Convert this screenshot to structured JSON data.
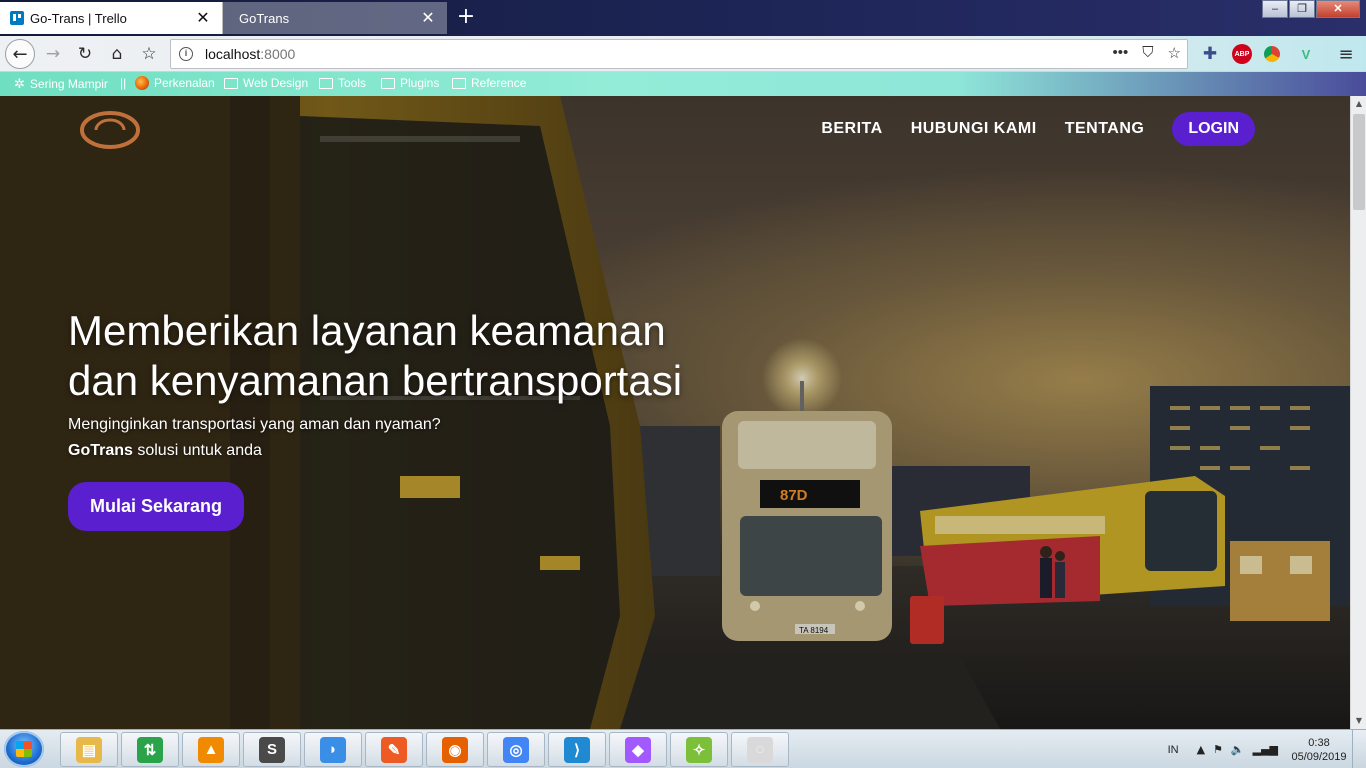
{
  "browser": {
    "tabs": [
      {
        "title": "Go-Trans | Trello",
        "active": false
      },
      {
        "title": "GoTrans",
        "active": true
      }
    ],
    "new_tab_glyph": "+",
    "close_glyph": "✕",
    "url": {
      "host": "localhost",
      "port": ":8000"
    },
    "url_actions": [
      "•••",
      "⛉",
      "☆"
    ],
    "bookmarks": [
      {
        "label": "Sering Mampir",
        "icon": "gear-icon"
      },
      {
        "label": "Perkenalan",
        "icon": "firefox-icon"
      },
      {
        "label": "Web Design",
        "icon": "folder-icon"
      },
      {
        "label": "Tools",
        "icon": "folder-icon"
      },
      {
        "label": "Plugins",
        "icon": "folder-icon"
      },
      {
        "label": "Reference",
        "icon": "folder-icon"
      }
    ],
    "extensions": {
      "abp": "ABP",
      "vue": "V"
    }
  },
  "site": {
    "nav": {
      "berita": "BERITA",
      "hubungi": "HUBUNGI KAMI",
      "tentang": "TENTANG",
      "login": "LOGIN"
    },
    "hero": {
      "title": "Memberikan layanan keamanan dan kenyamanan bertransportasi",
      "subtitle_line1": "Menginginkan transportasi yang aman dan nyaman?",
      "brand": "GoTrans",
      "subtitle_line2": " solusi untuk anda",
      "cta": "Mulai Sekarang"
    },
    "scene_text": {
      "bus_sign": "87D",
      "bus_plate": "TA 8194"
    },
    "colors": {
      "accent": "#5a1fcf",
      "logo": "#c0703a"
    }
  },
  "taskbar": {
    "apps": [
      {
        "name": "file-explorer",
        "color": "#e6b94a"
      },
      {
        "name": "download-manager",
        "color": "#2aa34a"
      },
      {
        "name": "vlc",
        "color": "#f08a00"
      },
      {
        "name": "sublime-text",
        "color": "#4a4a4a"
      },
      {
        "name": "dolphin",
        "color": "#3a8ee6"
      },
      {
        "name": "brackets-pen",
        "color": "#ee5a24"
      },
      {
        "name": "firefox",
        "color": "#e66000"
      },
      {
        "name": "chrome",
        "color": "#4285f4"
      },
      {
        "name": "vscode",
        "color": "#1f8ad2"
      },
      {
        "name": "figma",
        "color": "#a259ff"
      },
      {
        "name": "app-green",
        "color": "#7cbf3a"
      },
      {
        "name": "app-loading",
        "color": "#d9d9d9"
      }
    ],
    "tray": {
      "lang": "IN",
      "time": "0:38",
      "date": "05/09/2019"
    }
  }
}
